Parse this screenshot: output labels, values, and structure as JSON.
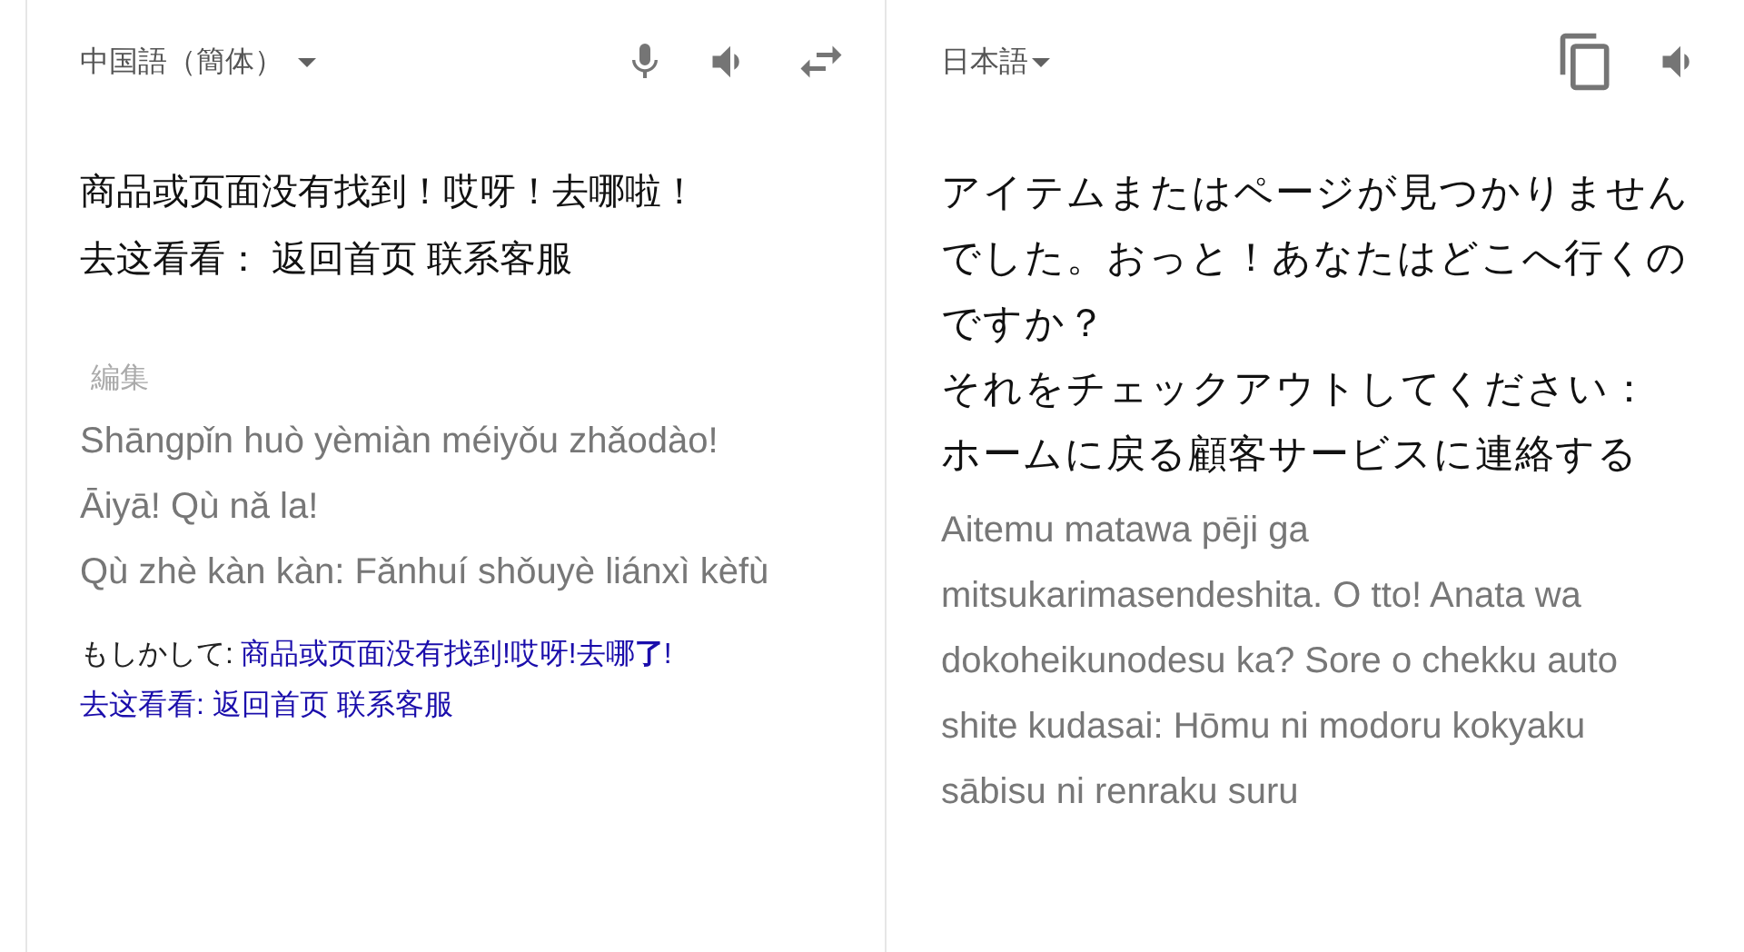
{
  "source": {
    "language": "中国語（簡体）",
    "text_lines": [
      "商品或页面没有找到！哎呀！去哪啦！",
      "去这看看： 返回首页 联系客服"
    ],
    "edit_label": "編集",
    "romanization": [
      "Shāngpǐn huò yèmiàn méiyǒu zhǎodào! Āiyā! Qù nǎ la!",
      "Qù zhè kàn kàn: Fǎnhuí shǒuyè liánxì kèfù"
    ],
    "suggestion": {
      "label": "もしかして:",
      "links": [
        "商品或页面没有找到!哎呀!去哪**了**!",
        "去这看看: 返回首页 联系客服"
      ]
    }
  },
  "target": {
    "language": "日本語",
    "text_lines": [
      "アイテムまたはページが見つかりませんでした。おっと！あなたはどこへ行くのですか？",
      "それをチェックアウトしてください：",
      "ホームに戻る顧客サービスに連絡する"
    ],
    "romanization": [
      "Aitemu matawa pēji ga mitsukarimasendeshita. O tto! Anata wa dokoheikunodesu ka? Sore o chekku auto shite kudasai: Hōmu ni modoru kokyaku sābisu ni renraku suru"
    ]
  }
}
